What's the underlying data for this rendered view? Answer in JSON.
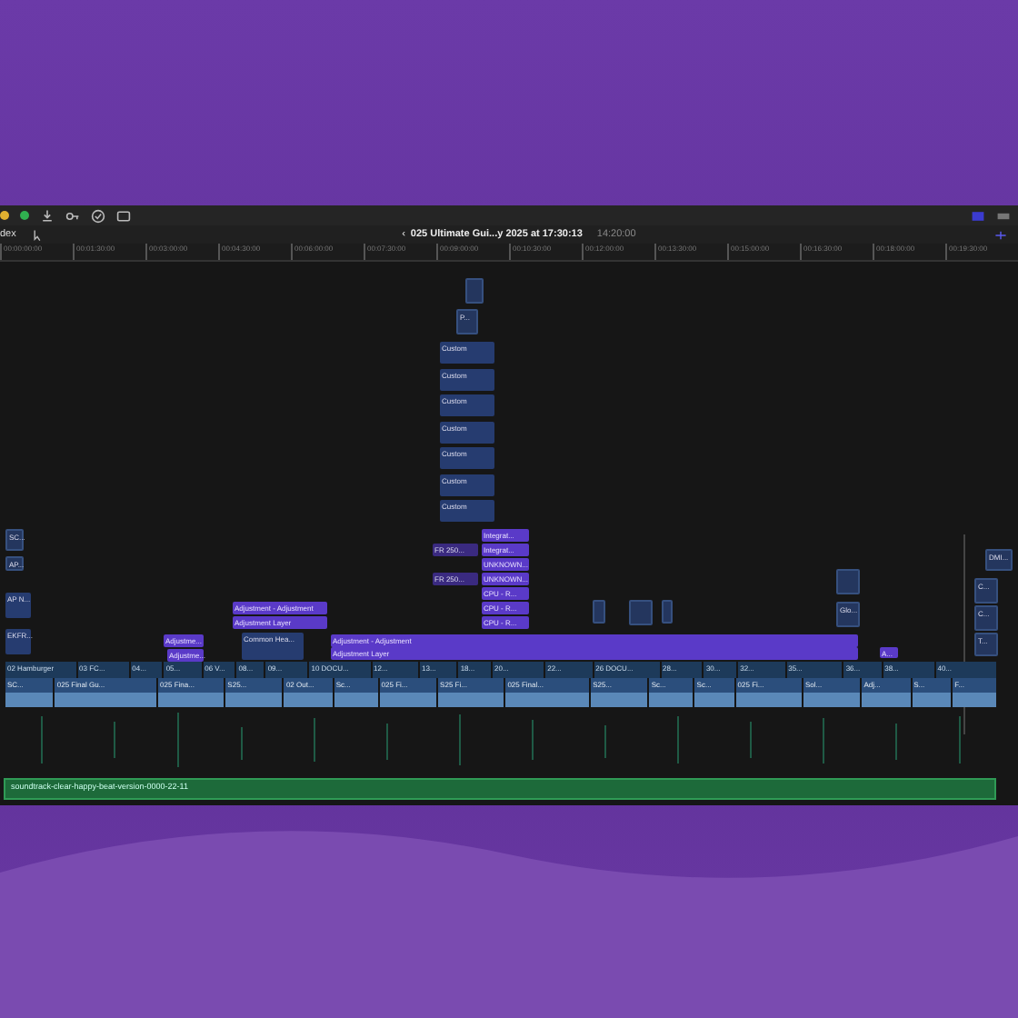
{
  "toolbar": {
    "index_button": "dex",
    "back_arrow": "‹",
    "project_title": "025 Ultimate Gui...y 2025 at 17:30:13",
    "duration": "14:20:00"
  },
  "ruler": [
    "00:00:00:00",
    "00:01:30:00",
    "00:03:00:00",
    "00:04:30:00",
    "00:06:00:00",
    "00:07:30:00",
    "00:09:00:00",
    "00:10:30:00",
    "00:12:00:00",
    "00:13:30:00",
    "00:15:00:00",
    "00:16:30:00",
    "00:18:00:00",
    "00:19:30:00"
  ],
  "clips": [
    {
      "kind": "video"
    },
    {
      "kind": "video",
      "label": "P..."
    },
    {
      "kind": "title",
      "label": "Custom"
    },
    {
      "kind": "title",
      "label": "Custom"
    },
    {
      "kind": "title",
      "label": "Custom"
    },
    {
      "kind": "title",
      "label": "Custom"
    },
    {
      "kind": "title",
      "label": "Custom"
    },
    {
      "kind": "title",
      "label": "Custom"
    },
    {
      "kind": "title",
      "label": "Custom"
    },
    {
      "kind": "adjustment",
      "label": "Integrat..."
    },
    {
      "kind": "adjustment",
      "label": "Integrat..."
    },
    {
      "kind": "adjustment",
      "label": "UNKNOWN..."
    },
    {
      "kind": "adjustment",
      "label": "UNKNOWN..."
    },
    {
      "kind": "adjustment",
      "label": "CPU - R..."
    },
    {
      "kind": "adjustment",
      "label": "CPU - R..."
    },
    {
      "kind": "adjustment",
      "label": "CPU - R..."
    },
    {
      "kind": "generator",
      "label": "FR 250..."
    },
    {
      "kind": "generator",
      "label": "FR 250..."
    },
    {
      "kind": "video",
      "label": "SC..."
    },
    {
      "kind": "video",
      "label": "AP..."
    },
    {
      "kind": "title",
      "label": "AP N..."
    },
    {
      "kind": "title",
      "label": "EKFR..."
    },
    {
      "kind": "adjustment",
      "label": "Adjustment - Adjustment"
    },
    {
      "kind": "adjustment",
      "label": "Adjustment Layer"
    },
    {
      "kind": "adjustment",
      "label": "Adjustme..."
    },
    {
      "kind": "adjustment",
      "label": "Adjustme..."
    },
    {
      "kind": "title",
      "label": "Common Hea..."
    },
    {
      "kind": "adjustment",
      "label": "Adjustment - Adjustment"
    },
    {
      "kind": "adjustment",
      "label": "Adjustment Layer"
    },
    {
      "kind": "adjustment",
      "label": "A..."
    },
    {
      "kind": "video"
    },
    {
      "kind": "video"
    },
    {
      "kind": "video"
    },
    {
      "kind": "video"
    },
    {
      "kind": "video",
      "label": "Glo..."
    },
    {
      "kind": "video",
      "label": "DMI..."
    },
    {
      "kind": "video",
      "label": "C..."
    },
    {
      "kind": "video",
      "label": "C..."
    },
    {
      "kind": "video",
      "label": "T..."
    }
  ],
  "connected_row": [
    "02 Hamburger",
    "03 FC...",
    "04...",
    "05...",
    "06 V...",
    "08...",
    "09...",
    "10 DOCU...",
    "12...",
    "13...",
    "18...",
    "20...",
    "22...",
    "26 DOCU...",
    "28...",
    "30...",
    "32...",
    "35...",
    "36...",
    "38...",
    "40..."
  ],
  "storyline": [
    "SC...",
    "025 Final Gu...",
    "025 Fina...",
    "S25...",
    "02 Out...",
    "Sc...",
    "025 Fi...",
    "S25 Fi...",
    "025 Final...",
    "S25...",
    "Sc...",
    "Sc...",
    "025 Fi...",
    "Sol...",
    "Adj...",
    "S...",
    "F..."
  ],
  "audio_clip": "soundtrack-clear-happy-beat-version-0000-22-11"
}
